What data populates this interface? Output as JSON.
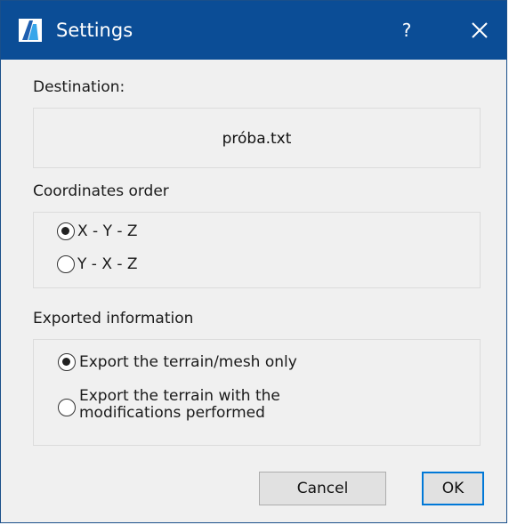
{
  "window": {
    "title": "Settings",
    "help_label": "?",
    "close_icon": "close-icon",
    "app_icon": "app-logo-icon",
    "titlebar_color": "#0b4d96"
  },
  "destination": {
    "label": "Destination:",
    "value": "próba.txt"
  },
  "coordinates": {
    "label": "Coordinates order",
    "options": [
      {
        "label": "X - Y - Z",
        "checked": true
      },
      {
        "label": "Y - X - Z",
        "checked": false
      }
    ]
  },
  "export": {
    "label": "Exported information",
    "options": [
      {
        "label": "Export the terrain/mesh only",
        "checked": true
      },
      {
        "label": "Export the terrain with the modifications performed",
        "checked": false
      }
    ]
  },
  "buttons": {
    "cancel": "Cancel",
    "ok": "OK",
    "accent_color": "#0078d7"
  }
}
